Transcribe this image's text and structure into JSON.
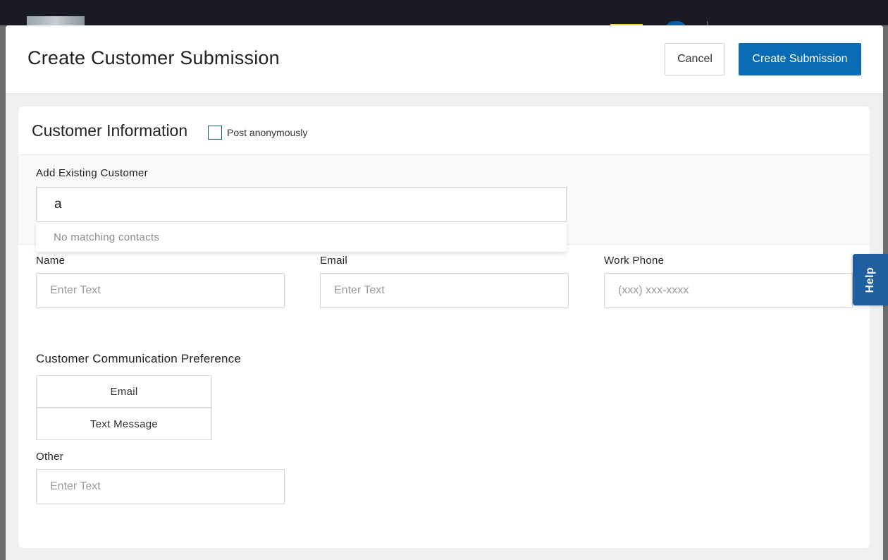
{
  "modal": {
    "title": "Create Customer Submission",
    "cancel_label": "Cancel",
    "create_label": "Create Submission"
  },
  "customer_info": {
    "title": "Customer Information",
    "anonymous_label": "Post anonymously",
    "anonymous_checked": false
  },
  "existing_customer": {
    "label": "Add Existing Customer",
    "value": "a",
    "dropdown_message": "No matching contacts"
  },
  "fields": {
    "name": {
      "label": "Name",
      "placeholder": "Enter Text"
    },
    "email": {
      "label": "Email",
      "placeholder": "Enter Text"
    },
    "work_phone": {
      "label": "Work Phone",
      "placeholder": "(xxx) xxx-xxxx"
    }
  },
  "communication": {
    "label": "Customer Communication Preference",
    "options": [
      "Email",
      "Text Message"
    ]
  },
  "other": {
    "label": "Other",
    "placeholder": "Enter Text"
  },
  "help": {
    "label": "Help"
  },
  "colors": {
    "primary": "#0a6cb5",
    "help_tab": "#1f5fa0",
    "checkbox_border": "#1f5b7c"
  }
}
